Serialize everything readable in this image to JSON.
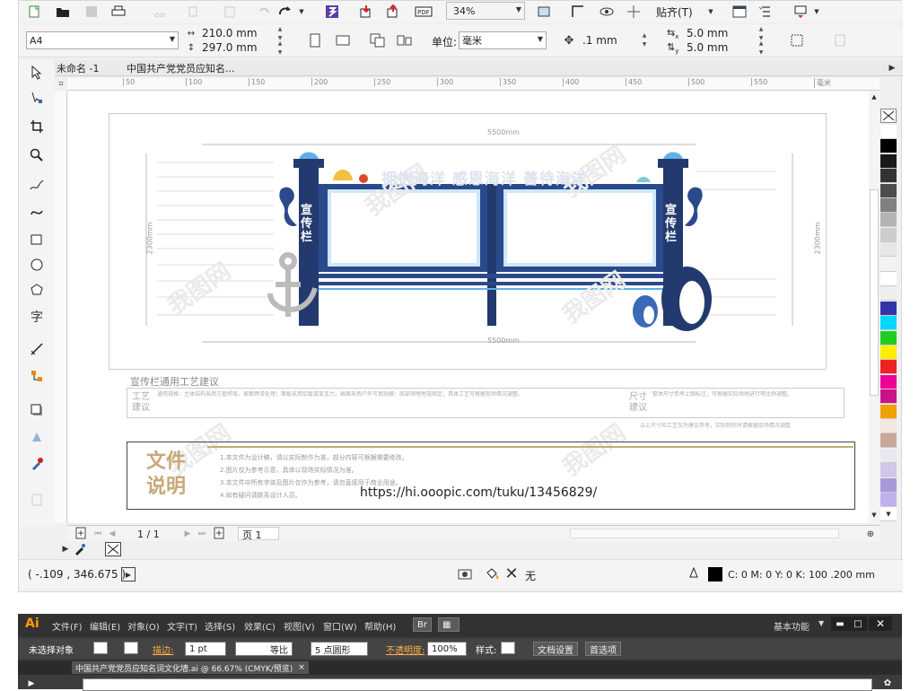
{
  "toolbar": {
    "zoom": "34%",
    "snap": "贴齐(T)",
    "page_size": "A4",
    "width": "210.0 mm",
    "height": "297.0 mm",
    "unit_label": "单位:",
    "unit": "毫米",
    "nudge": ".1 mm",
    "dup_x": "5.0 mm",
    "dup_y": "5.0 mm",
    "dup_x_sym": "x",
    "dup_y_sym": "y"
  },
  "tabs": [
    "未命名 -1",
    "中国共产党党员应知名..."
  ],
  "ruler": {
    "ticks": [
      "50",
      "100",
      "150",
      "200",
      "250",
      "300",
      "350",
      "400",
      "450",
      "500",
      "550",
      "毫米"
    ]
  },
  "design": {
    "dim_top": "5500mm",
    "dim_bottom": "5500mm",
    "dim_left": "2300mm",
    "dim_right": "2300mm",
    "slogan": "拥抱海洋 感恩海洋 善待海洋",
    "post_text": "宣传栏",
    "section_title": "宣传栏通用工艺建议",
    "craft_label": "工艺建议",
    "size_label": "尺寸建议",
    "spec_left": "通用规格：主体结构采用方管焊接，表面烤漆处理；面板采用铝板或亚克力，画面采用户外写真贴膜；底部预埋地笼固定，具体工艺可根据现场情况调整。",
    "spec_right": "整体尺寸参考上图标注，可根据实际场地进行等比例调整。",
    "foot_note": "以上尺寸和工艺仅为建议参考，实际制作时请根据现场情况调整",
    "doc_title": "文件说明",
    "doc_lines": [
      "1.本文件为设计稿，请以实际制作为准，部分内容可根据需要修改。",
      "2.图片仅为参考示意，具体以现场实际情况为准。",
      "3.本文件中所有字体及图片仅作为参考，请勿直接用于商业用途。",
      "4.如有疑问请联系设计人员。"
    ],
    "url": "https://hi.ooopic.com/tuku/13456829/",
    "watermark": "我图网"
  },
  "pager": {
    "current": "1 / 1",
    "page_tab": "页 1"
  },
  "status": {
    "coords": "( -.109 , 346.675 )",
    "fill_label": "无",
    "outline": "C: 0 M: 0 Y: 0 K: 100  .200 mm"
  },
  "palette": [
    "#ffffff",
    "#000000",
    "#1a1a1a",
    "#333333",
    "#4d4d4d",
    "#808080",
    "#b3b3b3",
    "#cccccc",
    "#e6e6e6",
    "#f2f2f2",
    "#ffffff",
    "#eeeeee",
    "#3333aa",
    "#00d8ff",
    "#22cc22",
    "#ffee00",
    "#ee2222",
    "#ee0099",
    "#cc1188",
    "#f0a000",
    "#f6e6e0",
    "#c8a898",
    "#e8e8f0",
    "#d0c8e8",
    "#a898d8",
    "#c0b0f0",
    "#ffffff"
  ],
  "ai": {
    "logo": "Ai",
    "menus": [
      "文件(F)",
      "编辑(E)",
      "对象(O)",
      "文字(T)",
      "选择(S)",
      "效果(C)",
      "视图(V)",
      "窗口(W)",
      "帮助(H)"
    ],
    "br": "Br",
    "workspace": "基本功能",
    "no_select": "未选择对象",
    "stroke_label": "描边:",
    "stroke_val": "1 pt",
    "line_style": "等比",
    "brush": "5 点圆形",
    "opacity_label": "不透明度:",
    "opacity": "100%",
    "style_label": "样式:",
    "doc_setup": "文档设置",
    "prefs": "首选项",
    "doc_tab": "中国共产党党员应知名词文化墙.ai @ 66.67% (CMYK/预览)",
    "doc_close": "×"
  }
}
